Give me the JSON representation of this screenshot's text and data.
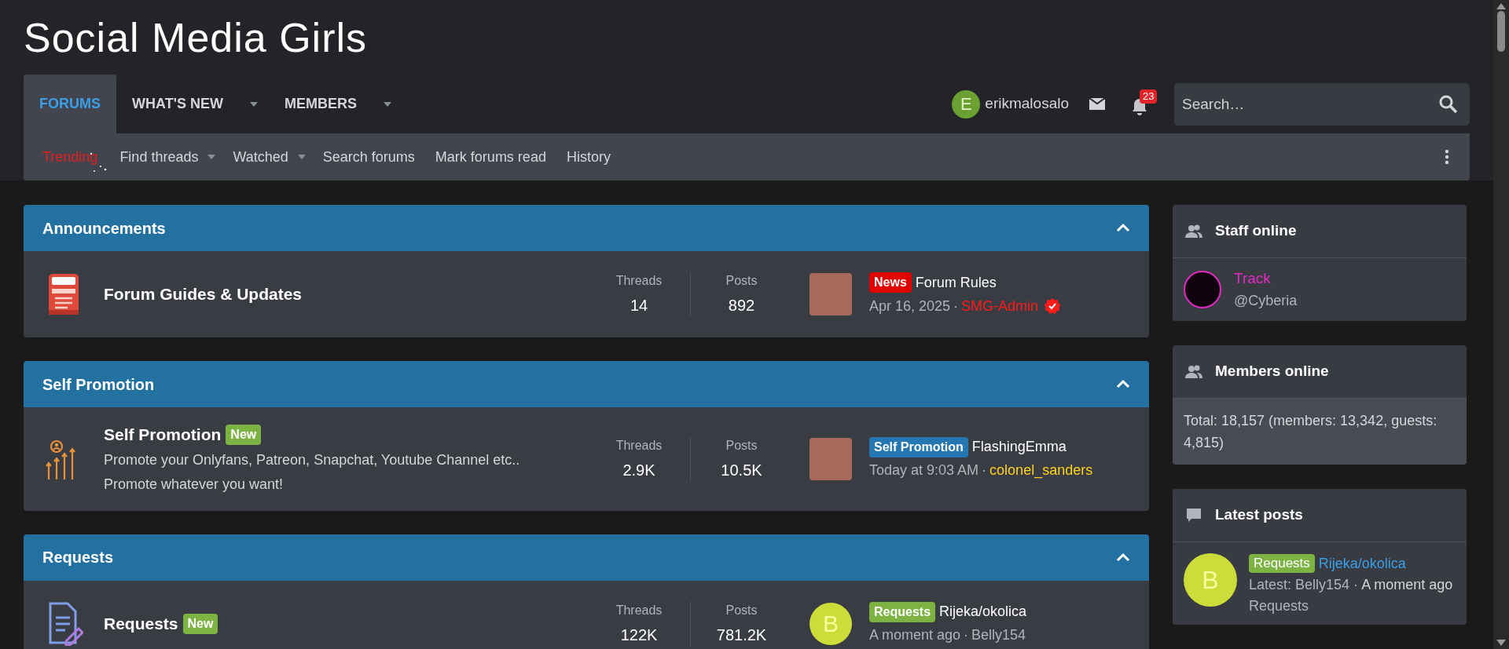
{
  "site_title": "Social Media Girls",
  "nav_tabs": [
    {
      "label": "FORUMS",
      "selected": true,
      "has_menu": false
    },
    {
      "label": "WHAT'S NEW",
      "selected": false,
      "has_menu": true
    },
    {
      "label": "MEMBERS",
      "selected": false,
      "has_menu": true
    }
  ],
  "user": {
    "name": "erikmalosalo",
    "avatar": {
      "kind": "letter",
      "letter": "E",
      "color": "#6ba032"
    }
  },
  "alerts_count": "23",
  "search": {
    "placeholder": "Search…"
  },
  "sub_nav": [
    {
      "label": "Trending",
      "kind": "trending",
      "has_menu": false
    },
    {
      "label": "Find threads",
      "kind": "link",
      "has_menu": true
    },
    {
      "label": "Watched",
      "kind": "link",
      "has_menu": true
    },
    {
      "label": "Search forums",
      "kind": "link",
      "has_menu": false
    },
    {
      "label": "Mark forums read",
      "kind": "link",
      "has_menu": false
    },
    {
      "label": "History",
      "kind": "link",
      "has_menu": false
    }
  ],
  "categories": [
    {
      "title": "Announcements",
      "expanded": true,
      "nodes": [
        {
          "kind": "rules",
          "title": "Forum Guides & Updates",
          "new": false,
          "threads_label": "Threads",
          "threads": "14",
          "posts_label": "Posts",
          "posts": "892",
          "latest": {
            "avatar": {
              "kind": "photo"
            },
            "prefix": {
              "label": "News",
              "color": "#e00000"
            },
            "title": "Forum Rules",
            "time": "Apr 16, 2025",
            "separator": "·",
            "user": {
              "name": "SMG-Admin",
              "color": "#ff1a1a"
            },
            "verified": true
          }
        }
      ]
    },
    {
      "title": "Self Promotion",
      "expanded": true,
      "nodes": [
        {
          "kind": "promotion",
          "title": "Self Promotion",
          "new": true,
          "new_label": "New",
          "description": [
            "Promote your Onlyfans, Patreon, Snapchat, Youtube Channel etc..",
            "Promote whatever you want!"
          ],
          "threads_label": "Threads",
          "threads": "2.9K",
          "posts_label": "Posts",
          "posts": "10.5K",
          "latest": {
            "avatar": {
              "kind": "photo"
            },
            "prefix": {
              "label": "Self Promotion",
              "color": "#2577b1"
            },
            "title": "FlashingEmma",
            "time": "Today at 9:03 AM",
            "separator": "·",
            "user": {
              "name": "colonel_sanders",
              "color": "#ffd21f"
            },
            "verified": false
          }
        }
      ]
    },
    {
      "title": "Requests",
      "expanded": true,
      "nodes": [
        {
          "kind": "requests",
          "title": "Requests",
          "new": true,
          "new_label": "New",
          "threads_label": "Threads",
          "threads": "122K",
          "posts_label": "Posts",
          "posts": "781.2K",
          "latest": {
            "avatar": {
              "kind": "letter",
              "letter": "B",
              "color": "#cddc39"
            },
            "prefix": {
              "label": "Requests",
              "color": "#7cb342"
            },
            "title": "Rijeka/okolica",
            "time": "A moment ago",
            "separator": "·",
            "user": {
              "name": "Belly154",
              "color": "#b0b4bb"
            },
            "verified": false
          }
        }
      ]
    }
  ],
  "sidebar": {
    "staff_online": {
      "title": "Staff online",
      "members": [
        {
          "name": "Track",
          "handle": "@Cyberia",
          "color": "#e02bc4"
        }
      ]
    },
    "members_online": {
      "title": "Members online",
      "summary": "Total: 18,157 (members: 13,342, guests: 4,815)"
    },
    "latest_posts": {
      "title": "Latest posts",
      "posts": [
        {
          "avatar": {
            "kind": "letter",
            "letter": "B",
            "color": "#cddc39"
          },
          "prefix": {
            "label": "Requests",
            "color": "#7cb342"
          },
          "title": "Rijeka/okolica",
          "meta_user": "Latest: Belly154",
          "separator": "·",
          "meta_time": "A moment ago",
          "forum": "Requests"
        }
      ]
    }
  }
}
